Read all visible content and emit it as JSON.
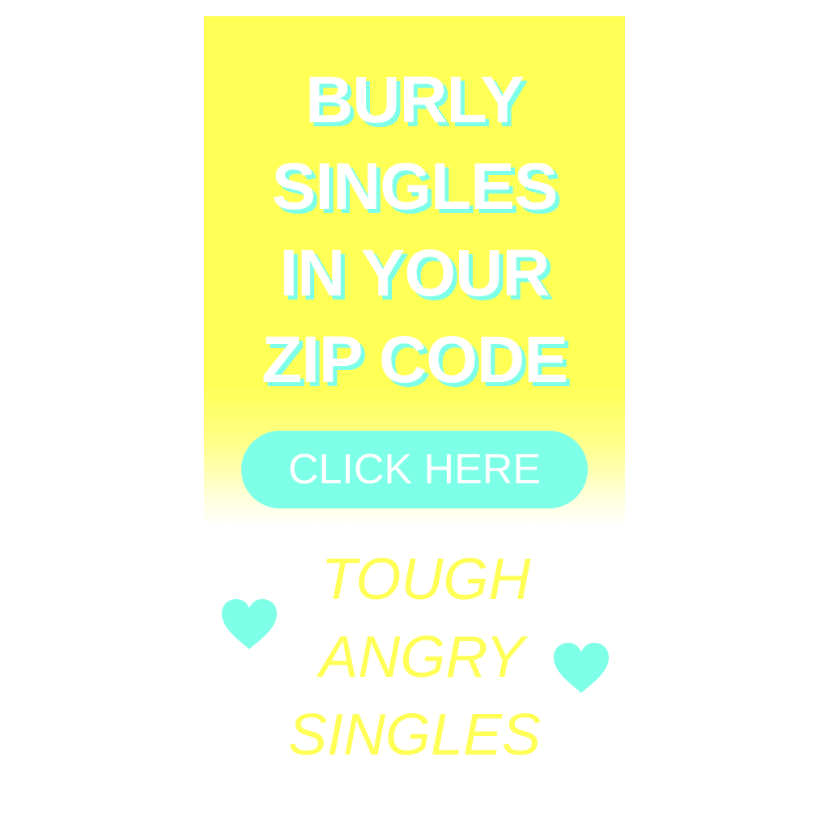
{
  "ad": {
    "headline": [
      "BURLY",
      "SINGLES",
      "IN YOUR",
      "ZIP CODE"
    ],
    "cta_label": "CLICK HERE",
    "tagline": [
      "TOUGH",
      "ANGRY",
      "SINGLES"
    ],
    "icons": [
      "heart-icon",
      "heart-icon"
    ]
  },
  "colors": {
    "panel": "#ffff55",
    "accent": "#7dffe8",
    "text_light": "#ffffff",
    "tagline": "#ffff55"
  }
}
